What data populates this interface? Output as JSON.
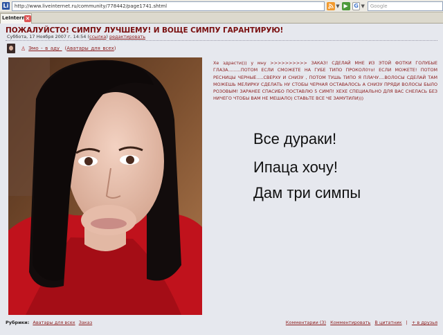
{
  "browser": {
    "url": "http://www.liveinternet.ru/community/778442/page1741.shtml",
    "favicon": "Li",
    "search_placeholder": "Google",
    "tab_title": "LeIntern...",
    "close_glyph": "×"
  },
  "post": {
    "title": "ПОЖАЛУЙСТО! СИМПУ ЛУЧШЕМУ! И ВОЩЕ СИМПУ ГАРАНТИРУЮ!",
    "date": "Суббота, 17 Ноября 2007 г. 14:54",
    "link_label": "ссылка",
    "edit_label": "редактировать",
    "author": "Эмо_-_в_аду_",
    "community": "Аватары_для_всех",
    "body": "Хе здрасти))) у мну >>>>>>>>>> ЗАКАЗ! СДЕЛАЙ МНЕ ИЗ ЭТОЙ ФОТКИ ГОЛУБЫЕ ГЛАЗА.........ПОТОМ ЕСЛИ СМОЖЕТЕ НА ГУБЕ ТИПО ПРОКОЛ0то! ЕСЛИ МОЖЕТЕ! ПОТОМ РЕСНИЦЫ ЧЕРНЫЕ.....СВЕРХУ И СНИЗУ , ПОТОМ ТУШЬ ТИПО Я ПЛАЧУ....ВОЛОСЫ СДЕЛАЙ ТАМ МОЖЕШЬ МЕЛИРКУ СДЕЛАТЬ НУ СТОБЫ ЧЕРНАЯ ОСТАВАЛОСЬ А СНИЗУ ПРЯДИ ВОЛОСЫ БЫЛО РОЗОВЫМ! ЗАРАНЕЕ СПАСИБО ПОСТАВЛЮ 5 СИМП! ХЕХЕ СПЕЦИАЛЬНО ДЛЯ ВАС СНЕЛАСЬ БЕЗ НИЧЕГО ЧТОБЫ ВАМ НЕ МЕШАЛО) СТАВЬТЕ ВСЕ ЧЕ ЗАМУТИЛИ)))"
  },
  "caption": {
    "line1": "Все дураки!",
    "line2": "Ипаца хочу!",
    "line3": "Дам три симпы"
  },
  "footer": {
    "rubric_label": "Рубрики:",
    "rubric1": "Аватары для всех",
    "rubric2": "Заказ",
    "comments": "Комментарии (3)",
    "comment_action": "Комментировать",
    "quote": "В цитатник",
    "friends": "+ в друзья"
  },
  "colors": {
    "title": "#7a1010",
    "link": "#8b1a1a",
    "background": "#e6e8ee"
  },
  "icons": {
    "rss": "rss-icon",
    "go": "go-arrow-icon",
    "search_engine": "google-icon",
    "user": "user-icon"
  }
}
